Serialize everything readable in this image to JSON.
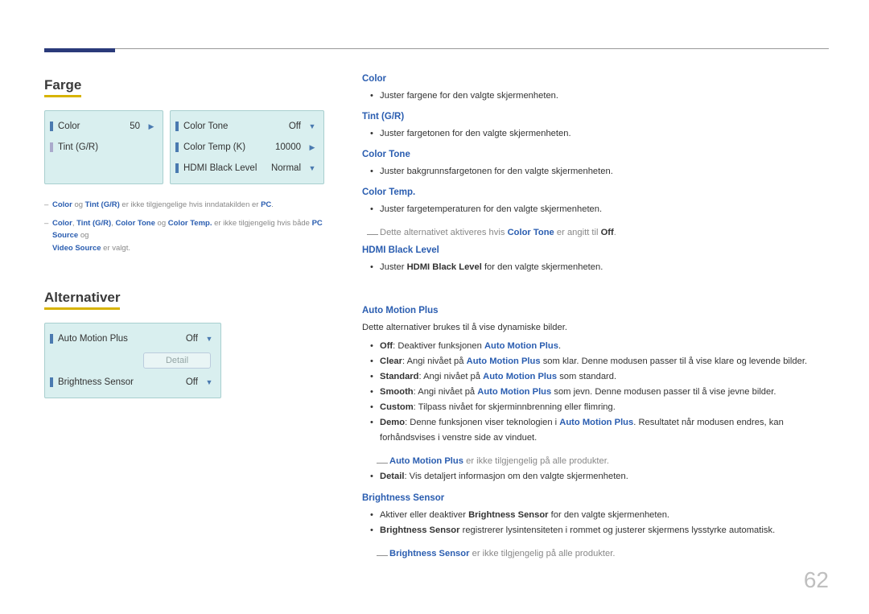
{
  "page_number": "62",
  "headings": {
    "farge": "Farge",
    "alternativer": "Alternativer"
  },
  "panel_farge_left": {
    "color": {
      "label": "Color",
      "value": "50",
      "arrow": "▶"
    },
    "tint": {
      "label": "Tint (G/R)",
      "value": "",
      "arrow": ""
    }
  },
  "panel_farge_right": {
    "tone": {
      "label": "Color Tone",
      "value": "Off",
      "arrow": "▼"
    },
    "tempk": {
      "label": "Color Temp (K)",
      "value": "10000",
      "arrow": "▶"
    },
    "hdmi": {
      "label": "HDMI Black Level",
      "value": "Normal",
      "arrow": "▼"
    }
  },
  "panel_alt": {
    "amp": {
      "label": "Auto Motion Plus",
      "value": "Off",
      "arrow": "▼"
    },
    "detail_btn": "Detail",
    "bs": {
      "label": "Brightness Sensor",
      "value": "Off",
      "arrow": "▼"
    }
  },
  "footnotes": {
    "f1a": "Color",
    "f1b": " og ",
    "f1c": "Tint (G/R)",
    "f1d": " er ikke tilgjengelige hvis inndatakilden er ",
    "f1e": "PC",
    "f1f": ".",
    "f2a": "Color",
    "f2b": ", ",
    "f2c": "Tint (G/R)",
    "f2d": ", ",
    "f2e": "Color Tone",
    "f2f": " og ",
    "f2g": "Color Temp.",
    "f2h": " er ikke tilgjengelig hvis både ",
    "f2i": "PC Source",
    "f2j": " og ",
    "f2k": "Video Source",
    "f2l": " er valgt."
  },
  "right": {
    "color_h": "Color",
    "color_t": "Juster fargene for den valgte skjermenheten.",
    "tint_h": "Tint (G/R)",
    "tint_t": "Juster fargetonen for den valgte skjermenheten.",
    "tone_h": "Color Tone",
    "tone_t": "Juster bakgrunnsfargetonen for den valgte skjermenheten.",
    "temp_h": "Color Temp.",
    "temp_t": "Juster fargetemperaturen for den valgte skjermenheten.",
    "temp_note_a": "Dette alternativet aktiveres hvis ",
    "temp_note_b": "Color Tone",
    "temp_note_c": " er angitt til ",
    "temp_note_d": "Off",
    "temp_note_e": ".",
    "hdmi_h": "HDMI Black Level",
    "hdmi_t1": "Juster ",
    "hdmi_t2": "HDMI Black Level",
    "hdmi_t3": " for den valgte skjermenheten.",
    "amp_h": "Auto Motion Plus",
    "amp_intro": "Dette alternativer brukes til å vise dynamiske bilder.",
    "amp_off_a": "Off",
    "amp_off_b": ": Deaktiver funksjonen ",
    "amp_off_c": "Auto Motion Plus",
    "amp_off_d": ".",
    "amp_clear_a": "Clear",
    "amp_clear_b": ": Angi nivået på ",
    "amp_clear_c": "Auto Motion Plus",
    "amp_clear_d": " som klar. Denne modusen passer til å vise klare og levende bilder.",
    "amp_std_a": "Standard",
    "amp_std_b": ": Angi nivået på ",
    "amp_std_c": "Auto Motion Plus",
    "amp_std_d": " som standard.",
    "amp_smooth_a": "Smooth",
    "amp_smooth_b": ": Angi nivået på ",
    "amp_smooth_c": "Auto Motion Plus",
    "amp_smooth_d": " som jevn. Denne modusen passer til å vise jevne bilder.",
    "amp_custom_a": "Custom",
    "amp_custom_b": ": Tilpass nivået for skjerminnbrenning eller flimring.",
    "amp_demo_a": "Demo",
    "amp_demo_b": ": Denne funksjonen viser teknologien i ",
    "amp_demo_c": "Auto Motion Plus",
    "amp_demo_d": ". Resultatet når modusen endres, kan forhåndsvises i venstre side av vinduet.",
    "amp_note_a": "Auto Motion Plus",
    "amp_note_b": " er ikke tilgjengelig på alle produkter.",
    "amp_detail_a": "Detail",
    "amp_detail_b": ": Vis detaljert informasjon om den valgte skjermenheten.",
    "bs_h": "Brightness Sensor",
    "bs_t1": "Aktiver eller deaktiver ",
    "bs_t2": "Brightness Sensor",
    "bs_t3": " for den valgte skjermenheten.",
    "bs_t4": "Brightness Sensor",
    "bs_t5": " registrerer lysintensiteten i rommet og justerer skjermens lysstyrke automatisk.",
    "bs_note_a": "Brightness Sensor",
    "bs_note_b": " er ikke tilgjengelig på alle produkter."
  }
}
